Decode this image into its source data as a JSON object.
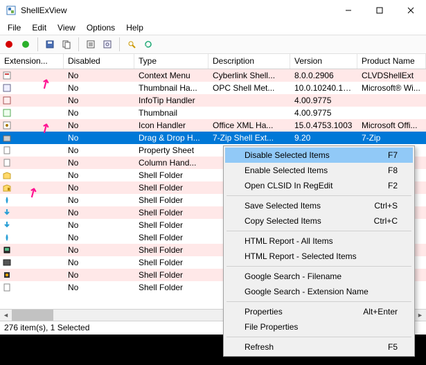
{
  "window": {
    "title": "ShellExView"
  },
  "menus": {
    "file": "File",
    "edit": "Edit",
    "view": "View",
    "options": "Options",
    "help": "Help"
  },
  "columns": {
    "ext": "Extension...",
    "dis": "Disabled",
    "type": "Type",
    "desc": "Description",
    "ver": "Version",
    "prod": "Product Name"
  },
  "rows": [
    {
      "pink": true,
      "dis": "No",
      "type": "Context Menu",
      "desc": "Cyberlink Shell...",
      "ver": "8.0.0.2906",
      "prod": "CLVDShellExt"
    },
    {
      "pink": false,
      "dis": "No",
      "type": "Thumbnail Ha...",
      "desc": "OPC Shell Met...",
      "ver": "10.0.10240.163...",
      "prod": "Microsoft® Wi..."
    },
    {
      "pink": true,
      "dis": "No",
      "type": "InfoTip Handler",
      "desc": "",
      "ver": "4.00.9775",
      "prod": ""
    },
    {
      "pink": false,
      "dis": "No",
      "type": "Thumbnail",
      "desc": "",
      "ver": "4.00.9775",
      "prod": ""
    },
    {
      "pink": true,
      "dis": "No",
      "type": "Icon Handler",
      "desc": "Office XML Ha...",
      "ver": "15.0.4753.1003",
      "prod": "Microsoft Offi..."
    },
    {
      "pink": false,
      "sel": true,
      "dis": "No",
      "type": "Drag & Drop H...",
      "desc": "7-Zip Shell Ext...",
      "ver": "9.20",
      "prod": "7-Zip"
    },
    {
      "pink": false,
      "dis": "No",
      "type": "Property Sheet",
      "desc": "",
      "ver": "",
      "prod": ""
    },
    {
      "pink": true,
      "dis": "No",
      "type": "Column Hand...",
      "desc": "",
      "ver": "",
      "prod": ""
    },
    {
      "pink": false,
      "dis": "No",
      "type": "Shell Folder",
      "desc": "",
      "ver": "",
      "prod": ""
    },
    {
      "pink": true,
      "dis": "No",
      "type": "Shell Folder",
      "desc": "",
      "ver": "",
      "prod": ""
    },
    {
      "pink": false,
      "dis": "No",
      "type": "Shell Folder",
      "desc": "",
      "ver": "",
      "prod": ""
    },
    {
      "pink": true,
      "dis": "No",
      "type": "Shell Folder",
      "desc": "",
      "ver": "",
      "prod": ""
    },
    {
      "pink": false,
      "dis": "No",
      "type": "Shell Folder",
      "desc": "",
      "ver": "",
      "prod": ""
    },
    {
      "pink": false,
      "dis": "No",
      "type": "Shell Folder",
      "desc": "",
      "ver": "",
      "prod": ""
    },
    {
      "pink": true,
      "dis": "No",
      "type": "Shell Folder",
      "desc": "",
      "ver": "",
      "prod": ""
    },
    {
      "pink": false,
      "dis": "No",
      "type": "Shell Folder",
      "desc": "",
      "ver": "",
      "prod": ""
    },
    {
      "pink": true,
      "dis": "No",
      "type": "Shell Folder",
      "desc": "",
      "ver": "",
      "prod": ""
    },
    {
      "pink": false,
      "dis": "No",
      "type": "Shell Folder",
      "desc": "",
      "ver": "",
      "prod": ""
    }
  ],
  "ctx": [
    {
      "lbl": "Disable Selected Items",
      "sc": "F7",
      "hl": true
    },
    {
      "lbl": "Enable Selected Items",
      "sc": "F8"
    },
    {
      "lbl": "Open CLSID In RegEdit",
      "sc": "F2"
    },
    {
      "sep": true
    },
    {
      "lbl": "Save Selected Items",
      "sc": "Ctrl+S"
    },
    {
      "lbl": "Copy Selected Items",
      "sc": "Ctrl+C"
    },
    {
      "sep": true
    },
    {
      "lbl": "HTML Report - All Items"
    },
    {
      "lbl": "HTML Report - Selected Items"
    },
    {
      "sep": true
    },
    {
      "lbl": "Google Search - Filename"
    },
    {
      "lbl": "Google Search - Extension Name"
    },
    {
      "sep": true
    },
    {
      "lbl": "Properties",
      "sc": "Alt+Enter"
    },
    {
      "lbl": "File Properties"
    },
    {
      "sep": true
    },
    {
      "lbl": "Refresh",
      "sc": "F5"
    }
  ],
  "status": "276 item(s), 1 Selected"
}
